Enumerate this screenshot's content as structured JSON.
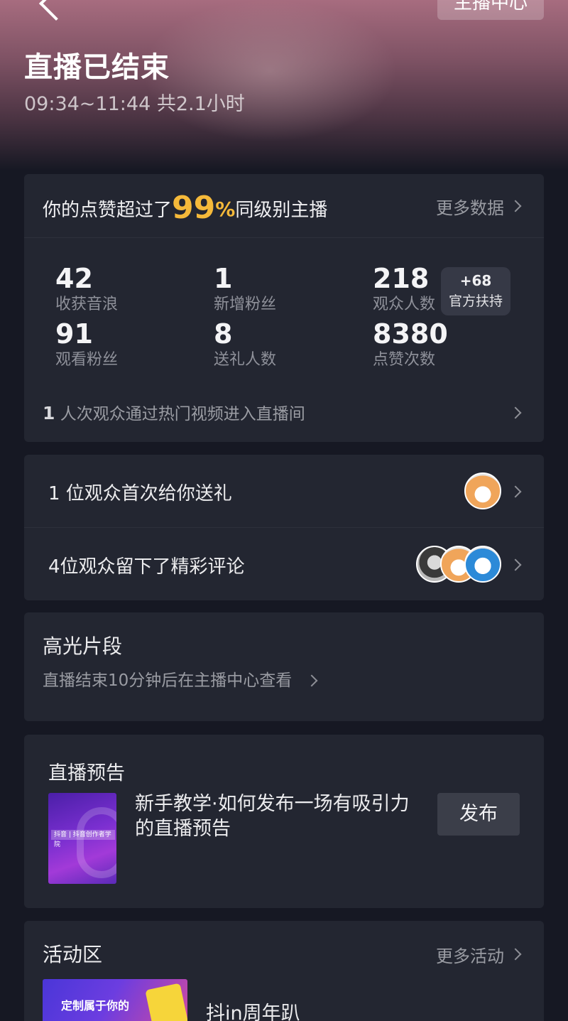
{
  "header": {
    "title": "直播已结束",
    "time_range": "09:34~11:44 共2.1小时",
    "anchor_center_label": "主播中心"
  },
  "stats_card": {
    "rank_prefix": "你的点赞超过了",
    "rank_percent": "99",
    "rank_percent_sign": "%",
    "rank_suffix": "同级别主播",
    "more_data": "更多数据",
    "stats": [
      {
        "value": "42",
        "label": "收获音浪"
      },
      {
        "value": "1",
        "label": "新增粉丝"
      },
      {
        "value": "218",
        "label": "观众人数"
      },
      {
        "value": "91",
        "label": "观看粉丝"
      },
      {
        "value": "8",
        "label": "送礼人数"
      },
      {
        "value": "8380",
        "label": "点赞次数"
      }
    ],
    "official_support": {
      "plus": "+68",
      "label": "官方扶持"
    },
    "hot_video_count": "1",
    "hot_video_text": "人次观众通过热门视频进入直播间"
  },
  "audience_card": {
    "first_gift": "1 位观众首次给你送礼",
    "comments": "4位观众留下了精彩评论"
  },
  "highlights": {
    "title": "高光片段",
    "subtitle": "直播结束10分钟后在主播中心查看"
  },
  "preview": {
    "title": "直播预告",
    "tutorial_text": "新手教学·如何发布一场有吸引力的直播预告",
    "publish_label": "发布",
    "thumb_caption": "抖音 | 抖音创作者学院"
  },
  "activities": {
    "title": "活动区",
    "more": "更多活动",
    "item_title": "抖in周年趴",
    "item_thumb_text": "定制属于你的"
  }
}
